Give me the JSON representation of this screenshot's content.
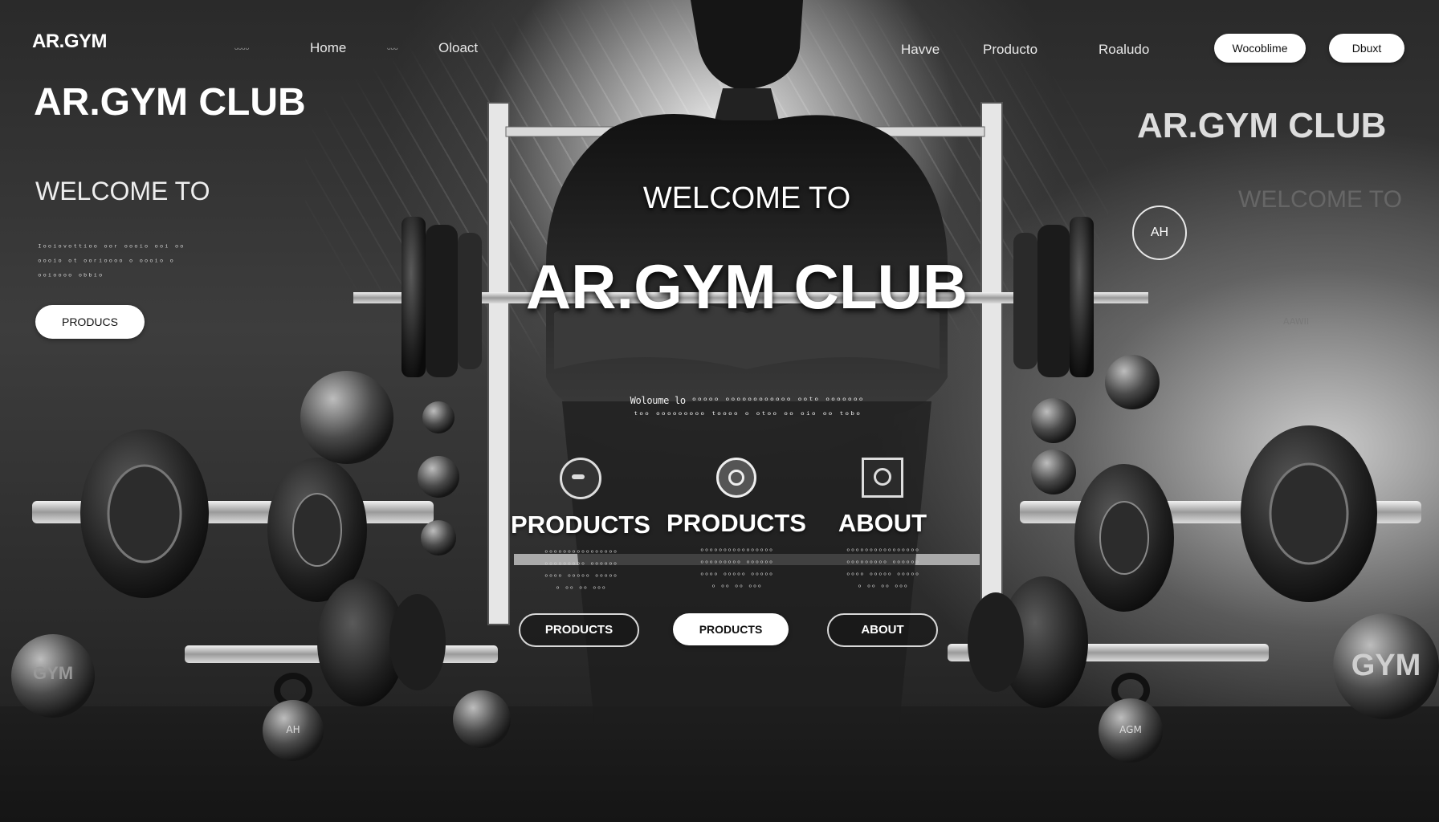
{
  "header": {
    "logo": "AR.GYM",
    "left_nav": [
      "ᵕᵕᵕᵕ",
      "Home",
      "ᵕᵕᵕ",
      "Oloact"
    ],
    "right_nav": [
      "Havve",
      "Producto",
      "Roaludo"
    ],
    "pill_buttons": [
      "Wocoblime",
      "Dbuxt"
    ]
  },
  "left_panel": {
    "title": "AR.GYM CLUB",
    "welcome": "WELCOME TO",
    "filler_lines": [
      "ᴵᵒᵒⁱᵒᵛᵒᵗᵗⁱᵒᵒ ᵒᵒʳ ᵒᵒᵒⁱᵒ ᵒᵒⁱ ᵒᵒ",
      "ᵒᵒᵒⁱᵒ ᵒᵗ ᵒᵒʳⁱᵒᵒᵒᵒ ᵒ ᵒᵒᵒⁱᵒ ᵒ",
      "ᵒᵒⁱᵒᵒᵒᵒ ᵒᵇᵇⁱᵒ"
    ],
    "button": "PRODUCS"
  },
  "right_panel": {
    "title": "AR.GYM CLUB",
    "welcome": "WELCOME TO",
    "badge": "AH",
    "ghost_text": "AAWII"
  },
  "hero": {
    "welcome": "WELCOME TO",
    "title": "AR.GYM CLUB",
    "subtitle_1": "Woloume lo ᵒᵒᵒᵒᵒ ᵒᵒᵒᵒᵒᵒᵒᵒᵒᵒᵒᵒ ᵒᵒᵗᵒ ᵒᵒᵒᵒᵒᵒᵒ",
    "subtitle_2": "ᵗᵒᵒ ᵒᵒᵒᵒᵒᵒᵒᵒᵒ ᵗᵒᵒᵒᵒ ᵒ ᵒᵗᵒᵒ ᵒᵒ ᵒⁱᵒ ᵒᵒ ᵗᵒᵇᵒ"
  },
  "sections": [
    {
      "title": "PRODUCTS",
      "button": "PRODUCTS",
      "filled": false
    },
    {
      "title": "PRODUCTS",
      "button": "PRODUCTS",
      "filled": true
    },
    {
      "title": "ABOUT",
      "button": "ABOUT",
      "filled": false
    }
  ],
  "section_filler": [
    "ᵒᵒᵒᵒᵒᵒᵒᵒᵒᵒᵒᵒᵒᵒᵒᵒ",
    "ᵒᵒᵒᵒᵒᵒᵒᵒᵒ ᵒᵒᵒᵒᵒᵒ",
    "ᵒᵒᵒᵒ ᵒᵒᵒᵒᵒ ᵒᵒᵒᵒᵒ",
    "ᵒ ᵒᵒ ᵒᵒ ᵒᵒᵒ"
  ],
  "decor": {
    "gym_ball_left": "GYM",
    "gym_ball_right": "GYM",
    "kettlebell_left": "AH",
    "kettlebell_right": "AGM"
  },
  "colors": {
    "background": "#2e2e2e",
    "accent": "#ffffff",
    "button_text": "#111111"
  }
}
